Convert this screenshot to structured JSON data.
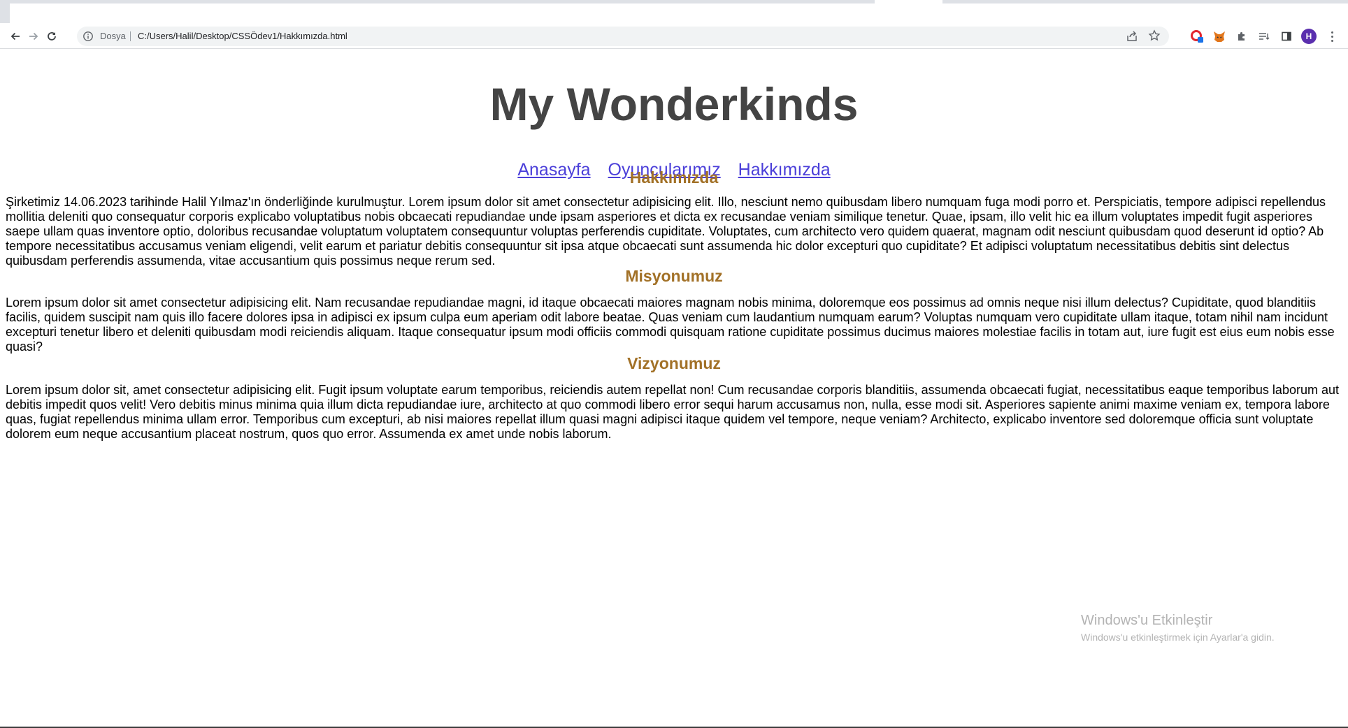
{
  "browser": {
    "scheme_label": "Dosya",
    "url": "C:/Users/Halil/Desktop/CSSÖdev1/Hakkımızda.html",
    "profile_initial": "H",
    "icons": [
      "back-icon",
      "forward-icon",
      "reload-icon",
      "info-icon",
      "share-icon",
      "star-icon",
      "opera-extension-icon",
      "metamask-fox-icon",
      "puzzle-extensions-icon",
      "reading-list-icon",
      "side-panel-icon",
      "menu-icon"
    ]
  },
  "page": {
    "title": "My Wonderkinds",
    "nav": [
      "Anasayfa",
      "Oyuncularımız",
      "Hakkımızda"
    ],
    "sections": [
      {
        "heading": "Hakkımızda",
        "text": "Şirketimiz 14.06.2023 tarihinde Halil Yılmaz'ın önderliğinde kurulmuştur. Lorem ipsum dolor sit amet consectetur adipisicing elit. Illo, nesciunt nemo quibusdam libero numquam fuga modi porro et. Perspiciatis, tempore adipisci repellendus mollitia deleniti quo consequatur corporis explicabo voluptatibus nobis obcaecati repudiandae unde ipsam asperiores et dicta ex recusandae veniam similique tenetur. Quae, ipsam, illo velit hic ea illum voluptates impedit fugit asperiores saepe ullam quas inventore optio, doloribus recusandae voluptatum voluptatem consequuntur voluptas perferendis cupiditate. Voluptates, cum architecto vero quidem quaerat, magnam odit nesciunt quibusdam quod deserunt id optio? Ab tempore necessitatibus accusamus veniam eligendi, velit earum et pariatur debitis consequuntur sit ipsa atque obcaecati sunt assumenda hic dolor excepturi quo cupiditate? Et adipisci voluptatum necessitatibus debitis sint delectus quibusdam perferendis assumenda, vitae accusantium quis possimus neque rerum sed."
      },
      {
        "heading": "Misyonumuz",
        "text": "Lorem ipsum dolor sit amet consectetur adipisicing elit. Nam recusandae repudiandae magni, id itaque obcaecati maiores magnam nobis minima, doloremque eos possimus ad omnis neque nisi illum delectus? Cupiditate, quod blanditiis facilis, quidem suscipit nam quis illo facere dolores ipsa in adipisci ex ipsum culpa eum aperiam odit labore beatae. Quas veniam cum laudantium numquam earum? Voluptas numquam vero cupiditate ullam itaque, totam nihil nam incidunt excepturi tenetur libero et deleniti quibusdam modi reiciendis aliquam. Itaque consequatur ipsum modi officiis commodi quisquam ratione cupiditate possimus ducimus maiores molestiae facilis in totam aut, iure fugit est eius eum nobis esse quasi?"
      },
      {
        "heading": "Vizyonumuz",
        "text": "Lorem ipsum dolor sit, amet consectetur adipisicing elit. Fugit ipsum voluptate earum temporibus, reiciendis autem repellat non! Cum recusandae corporis blanditiis, assumenda obcaecati fugiat, necessitatibus eaque temporibus laborum aut debitis impedit quos velit! Vero debitis minus minima quia illum dicta repudiandae iure, architecto at quo commodi libero error sequi harum accusamus non, nulla, esse modi sit. Asperiores sapiente animi maxime veniam ex, tempora labore quas, fugiat repellendus minima ullam error. Temporibus cum excepturi, ab nisi maiores repellat illum quasi magni adipisci itaque quidem vel tempore, neque veniam? Architecto, explicabo inventore sed doloremque officia sunt voluptate dolorem eum neque accusantium placeat nostrum, quos quo error. Assumenda ex amet unde nobis laborum."
      }
    ]
  },
  "watermark": {
    "line1": "Windows'u Etkinleştir",
    "line2": "Windows'u etkinleştirmek için Ayarlar'a gidin."
  },
  "colors": {
    "title": "#444444",
    "link": "#4b3fd9",
    "section_heading": "#a27127",
    "profile_avatar": "#5a2fae"
  }
}
